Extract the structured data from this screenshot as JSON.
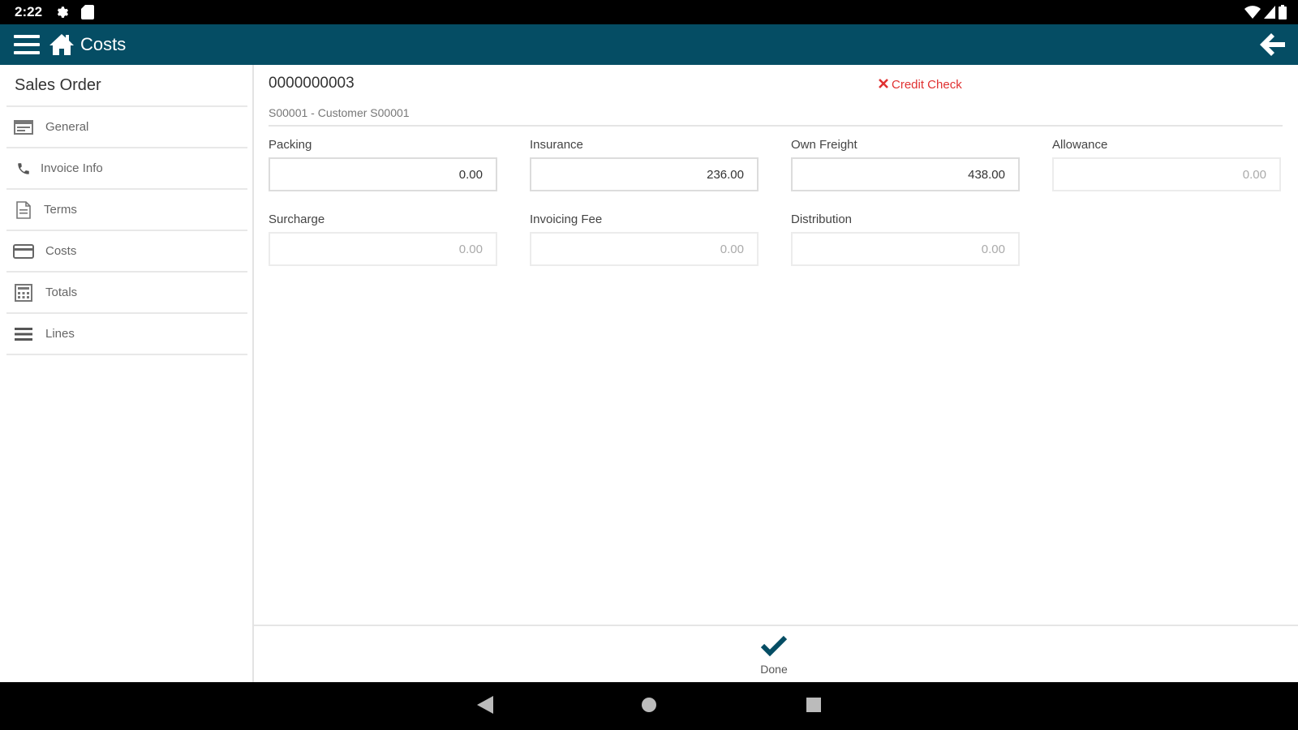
{
  "status_bar": {
    "time": "2:22"
  },
  "app_bar": {
    "title": "Costs"
  },
  "sidebar": {
    "title": "Sales Order",
    "items": [
      {
        "label": "General",
        "icon": "card-list-icon"
      },
      {
        "label": "Invoice Info",
        "icon": "phone-icon"
      },
      {
        "label": "Terms",
        "icon": "document-icon"
      },
      {
        "label": "Costs",
        "icon": "credit-card-icon"
      },
      {
        "label": "Totals",
        "icon": "calculator-icon"
      },
      {
        "label": "Lines",
        "icon": "list-icon"
      }
    ]
  },
  "header": {
    "doc_number": "0000000003",
    "credit_check": "Credit Check",
    "customer": "S00001 - Customer S00001"
  },
  "fields": {
    "packing": {
      "label": "Packing",
      "value": "0.00"
    },
    "insurance": {
      "label": "Insurance",
      "value": "236.00"
    },
    "own_freight": {
      "label": "Own Freight",
      "value": "438.00"
    },
    "allowance": {
      "label": "Allowance",
      "value": "0.00"
    },
    "surcharge": {
      "label": "Surcharge",
      "value": "0.00"
    },
    "invoicing_fee": {
      "label": "Invoicing Fee",
      "value": "0.00"
    },
    "distribution": {
      "label": "Distribution",
      "value": "0.00"
    }
  },
  "footer": {
    "done_label": "Done"
  },
  "colors": {
    "app_bar": "#054d64",
    "accent": "#054d64",
    "error": "#e03131"
  }
}
